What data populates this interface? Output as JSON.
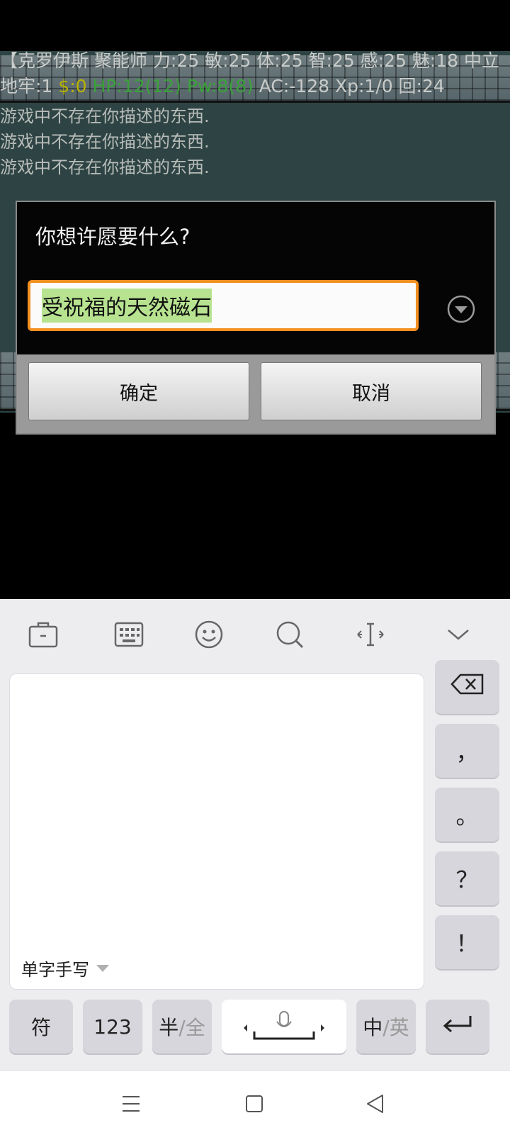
{
  "game": {
    "status_line_1": "【克罗伊斯 聚能师   力:25 敏:25 体:25 智:25 感:25 魅:18 中立",
    "status_line_2": {
      "dungeon": "地牢:1",
      "gold": "$:0",
      "hp": "HP:12(12)",
      "pw": "Pw:8(8)",
      "rest": "AC:-128 Xp:1/0 回:24"
    },
    "messages": [
      "游戏中不存在你描述的东西.",
      "游戏中不存在你描述的东西.",
      "游戏中不存在你描述的东西."
    ]
  },
  "dialog": {
    "title": "你想许愿要什么?",
    "input_value": "受祝福的天然磁石",
    "ok_label": "确定",
    "cancel_label": "取消"
  },
  "keyboard": {
    "toolbar_icons": [
      "briefcase-icon",
      "keyboard-icon",
      "emoji-icon",
      "search-icon",
      "cursor-move-icon",
      "chevron-down-icon"
    ],
    "handwriting_mode": "单字手写",
    "side_keys": {
      "comma": "，",
      "period": "。",
      "question": "？",
      "exclaim": "！"
    },
    "bottom_keys": {
      "symbols": "符",
      "numbers": "123",
      "half_width": "半",
      "full_width": "/全",
      "chinese": "中",
      "english": "/英"
    }
  },
  "colors": {
    "input_border": "#f39021",
    "selection": "#b7e390",
    "gold_text": "#b9b400",
    "green_text": "#3aa23a"
  }
}
